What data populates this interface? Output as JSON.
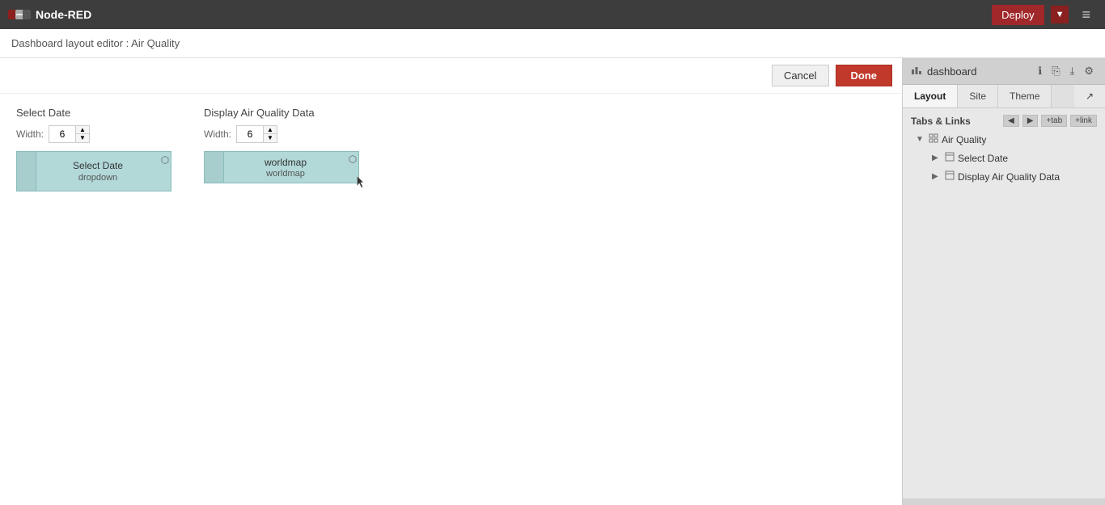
{
  "topbar": {
    "app_name": "Node-RED",
    "deploy_label": "Deploy",
    "deploy_dropdown_symbol": "▼",
    "hamburger": "≡"
  },
  "breadcrumb": {
    "text": "Dashboard layout editor : Air Quality"
  },
  "editor": {
    "cancel_label": "Cancel",
    "done_label": "Done",
    "group1": {
      "title": "Select Date",
      "width_label": "Width:",
      "width_value": "6",
      "widget": {
        "title": "Select Date",
        "subtitle": "dropdown",
        "resize_icon": "⬡"
      }
    },
    "group2": {
      "title": "Display Air Quality Data",
      "width_label": "Width:",
      "width_value": "6",
      "widget": {
        "title": "worldmap",
        "subtitle": "worldmap",
        "resize_icon": "⬡"
      }
    }
  },
  "right_panel": {
    "dashboard_label": "dashboard",
    "dashboard_icon": "📊",
    "actions": {
      "info": "ℹ",
      "copy": "⎘",
      "export": "⤓",
      "settings": "⚙",
      "external": "↗"
    },
    "tabs": [
      {
        "label": "Layout",
        "active": true
      },
      {
        "label": "Site",
        "active": false
      },
      {
        "label": "Theme",
        "active": false
      },
      {
        "label": "↗",
        "active": false,
        "external": true
      }
    ],
    "tabs_links_label": "Tabs & Links",
    "tl_buttons": [
      "◀",
      "▶",
      "+tab",
      "+link"
    ],
    "tree": {
      "air_quality_label": "Air Quality",
      "select_date_label": "Select Date",
      "display_label": "Display Air Quality Data"
    }
  }
}
